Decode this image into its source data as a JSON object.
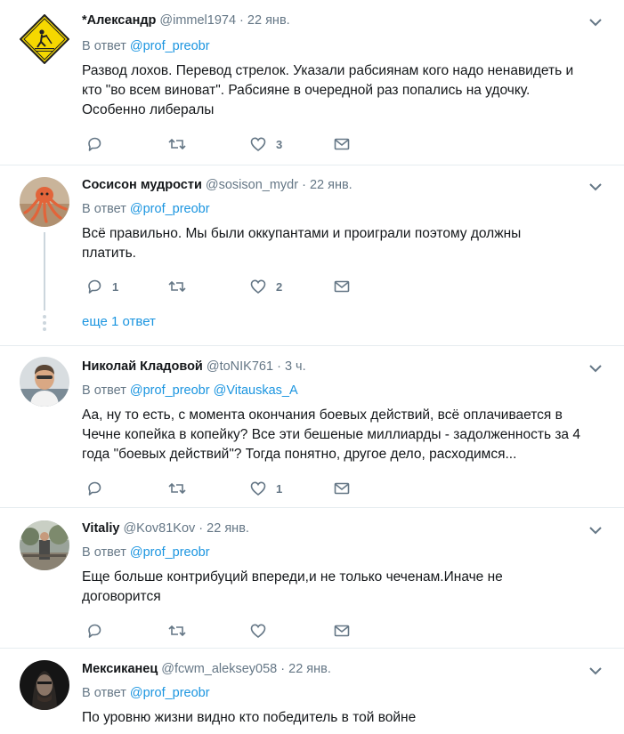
{
  "tweets": [
    {
      "name": "*Александр",
      "handle": "@immel1974",
      "time": "22 янв.",
      "reply_label": "В ответ",
      "mentions": [
        "@prof_preobr"
      ],
      "text_lines": [
        "Развод лохов. Перевод стрелок. Указали рабсиянам кого надо ненавидеть и",
        "кто \"во всем виноват\". Рабсияне в очередной раз попались на удочку.",
        "Особенно либералы"
      ],
      "reply_count": "",
      "like_count": "3",
      "avatar": "warning-sign-avatar"
    },
    {
      "name": "Сосисон мудрости",
      "handle": "@sosison_mydr",
      "time": "22 янв.",
      "reply_label": "В ответ",
      "mentions": [
        "@prof_preobr"
      ],
      "text_lines": [
        "Всё правильно. Мы были оккупантами и проиграли поэтому должны",
        "платить."
      ],
      "reply_count": "1",
      "like_count": "2",
      "more_replies": "еще 1 ответ",
      "avatar": "octopus-avatar"
    },
    {
      "name": "Николай Кладовой",
      "handle": "@toNIK761",
      "time": "3 ч.",
      "reply_label": "В ответ",
      "mentions": [
        "@prof_preobr",
        "@Vitauskas_A"
      ],
      "text_lines": [
        "Аа, ну то есть, с момента окончания боевых действий, всё оплачивается в",
        "Чечне копейка в копейку? Все эти бешеные миллиарды - задолженность за 4",
        "года \"боевых действий\"? Тогда понятно, другое дело, расходимся..."
      ],
      "reply_count": "",
      "like_count": "1",
      "avatar": "man-photo-avatar"
    },
    {
      "name": "Vitaliy",
      "handle": "@Kov81Kov",
      "time": "22 янв.",
      "reply_label": "В ответ",
      "mentions": [
        "@prof_preobr"
      ],
      "text_lines": [
        "Еще больше контрибуций впереди,и не только чеченам.Иначе не",
        "договорится"
      ],
      "reply_count": "",
      "like_count": "",
      "avatar": "park-photo-avatar"
    },
    {
      "name": "Мексиканец",
      "handle": "@fcwm_aleksey058",
      "time": "22 янв.",
      "reply_label": "В ответ",
      "mentions": [
        "@prof_preobr"
      ],
      "text_lines": [
        "По уровню жизни видно кто победитель в той войне"
      ],
      "avatar": "dark-portrait-avatar"
    }
  ],
  "colors": {
    "link": "#1b95e0",
    "secondary": "#657786",
    "text": "#14171a",
    "border": "#e6ecf0",
    "thread": "#ccd6dd"
  }
}
